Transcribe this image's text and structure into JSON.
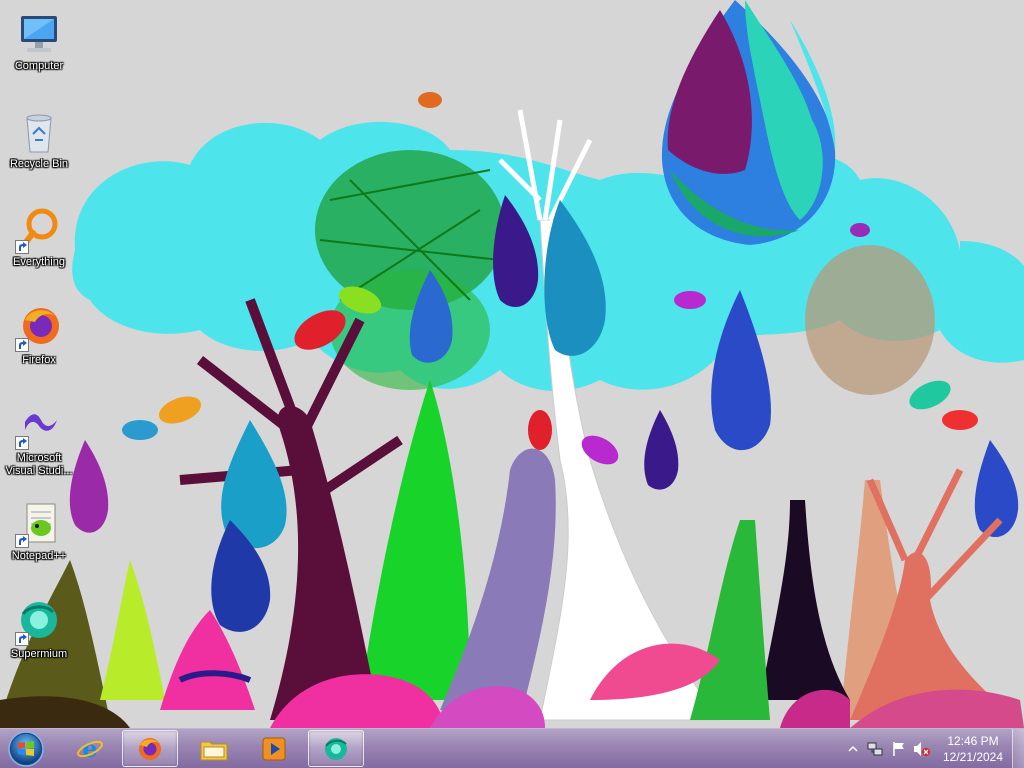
{
  "desktop": {
    "icons": [
      {
        "label": "Computer",
        "icon": "computer-icon"
      },
      {
        "label": "Recycle Bin",
        "icon": "recycle-bin-icon"
      },
      {
        "label": "Everything",
        "icon": "everything-icon"
      },
      {
        "label": "Firefox",
        "icon": "firefox-icon"
      },
      {
        "label": "Microsoft Visual Studi...",
        "icon": "visual-studio-icon"
      },
      {
        "label": "Notepad++",
        "icon": "notepadplusplus-icon"
      },
      {
        "label": "Supermium",
        "icon": "supermium-icon"
      }
    ]
  },
  "taskbar": {
    "start_icon": "windows-start-icon",
    "pinned": [
      {
        "icon": "internet-explorer-icon",
        "active": false
      },
      {
        "icon": "firefox-icon",
        "active": true
      },
      {
        "icon": "file-explorer-icon",
        "active": false
      },
      {
        "icon": "media-player-icon",
        "active": false
      },
      {
        "icon": "supermium-icon",
        "active": true
      }
    ],
    "tray": {
      "icons": [
        "show-hidden-icons-arrow",
        "network-icon",
        "action-center-flag-icon",
        "volume-muted-icon"
      ],
      "time": "12:46 PM",
      "date": "12/21/2024"
    }
  },
  "colors": {
    "taskbar": "#9880b0",
    "sky_cloud": "#4ee4ec",
    "wallpaper_bg": "#d4d4d4"
  }
}
